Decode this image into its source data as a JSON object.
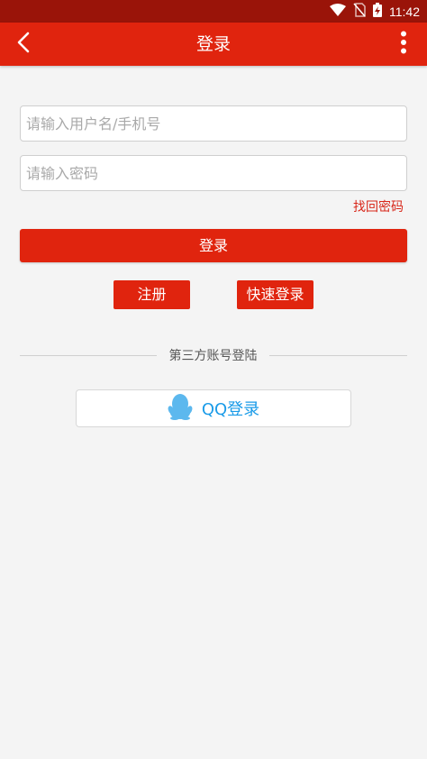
{
  "status_bar": {
    "time": "11:42",
    "icons": [
      "wifi-icon",
      "no-sim-icon",
      "battery-charging-icon"
    ]
  },
  "app_bar": {
    "title": "登录",
    "back_icon": "chevron-left-icon",
    "more_icon": "more-vertical-icon"
  },
  "form": {
    "username_placeholder": "请输入用户名/手机号",
    "username_value": "",
    "password_placeholder": "请输入密码",
    "password_value": "",
    "forgot_password": "找回密码",
    "login_label": "登录"
  },
  "actions": {
    "register_label": "注册",
    "quick_login_label": "快速登录"
  },
  "third_party": {
    "divider_label": "第三方账号登陆",
    "qq_label": "QQ登录",
    "qq_icon": "qq-penguin-icon"
  },
  "colors": {
    "status_bar": "#9a1409",
    "primary": "#e0240e",
    "link": "#d8271a",
    "qq_blue": "#1a9be8",
    "background": "#f4f4f4"
  }
}
